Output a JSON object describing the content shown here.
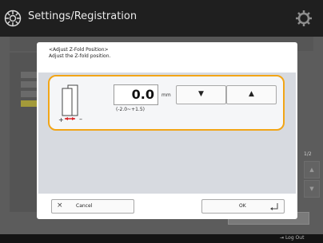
{
  "window": {
    "title": "Settings/Registration"
  },
  "dialog": {
    "title": "<Adjust Z-Fold Position>",
    "subtitle": "Adjust the Z-fold position.",
    "value": "0.0",
    "unit": "mm",
    "range": "(-2.0~+1.5)",
    "minus_label": "–",
    "plus_label": "+",
    "down_arrow": "▼",
    "up_arrow": "▲",
    "cancel_label": "Cancel",
    "ok_label": "OK"
  },
  "background": {
    "page_indicator": "1/2",
    "scroll_up": "▲",
    "scroll_down": "▼"
  },
  "status_bar": {
    "logout_label": "Log Out"
  },
  "colors": {
    "accent": "#f2a516",
    "arrow_red": "#d9262a"
  }
}
